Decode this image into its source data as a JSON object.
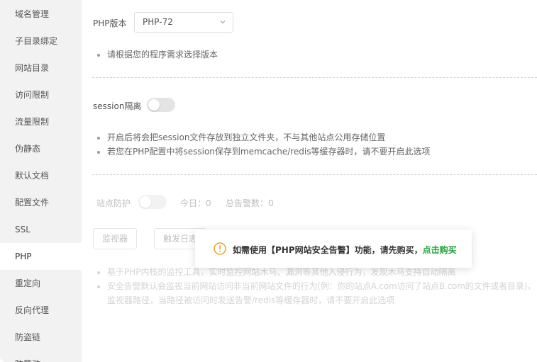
{
  "sidebar": {
    "items": [
      {
        "label": "域名管理"
      },
      {
        "label": "子目录绑定"
      },
      {
        "label": "网站目录"
      },
      {
        "label": "访问限制"
      },
      {
        "label": "流量限制"
      },
      {
        "label": "伪静态"
      },
      {
        "label": "默认文档"
      },
      {
        "label": "配置文件"
      },
      {
        "label": "SSL"
      },
      {
        "label": "PHP",
        "active": true
      },
      {
        "label": "重定向"
      },
      {
        "label": "反向代理"
      },
      {
        "label": "防盗链"
      },
      {
        "label": "防篡改"
      }
    ]
  },
  "php": {
    "label": "PHP版本",
    "selected": "PHP-72",
    "tip": "请根据您的程序需求选择版本"
  },
  "session": {
    "label": "session隔离",
    "enabled": false,
    "tips": [
      "开启后将会把session文件存放到独立文件夹，不与其他站点公用存储位置",
      "若您在PHP配置中将session保存到memcache/redis等缓存器时，请不要开启此选项"
    ]
  },
  "guard": {
    "label": "站点防护",
    "enabled": false,
    "today_label": "今日：",
    "today_value": "0",
    "total_label": "总告警数：",
    "total_value": "0",
    "buttons": {
      "monitor": "监视器",
      "trigger_log": "触发日志"
    },
    "tips": [
      "基于PHP内核的监控工具，实时监控网站木马、漏洞等其他入侵行为，发现木马支持自动隔离",
      "安全告警默认会监视当前网站访问非当前网站文件的行为(例：你的站点A.com访问了站点B.com的文件或者目录)，",
      "监视器路径，当路径被访问时发送告警/redis等缓存器时，请不要开启此选项"
    ]
  },
  "toast": {
    "message": "如需使用【PHP网站安全告警】功能，请先购买，",
    "link": "点击购买",
    "icon": "warning-circle-icon",
    "accent": "#f0a020",
    "link_color": "#20a53a"
  }
}
